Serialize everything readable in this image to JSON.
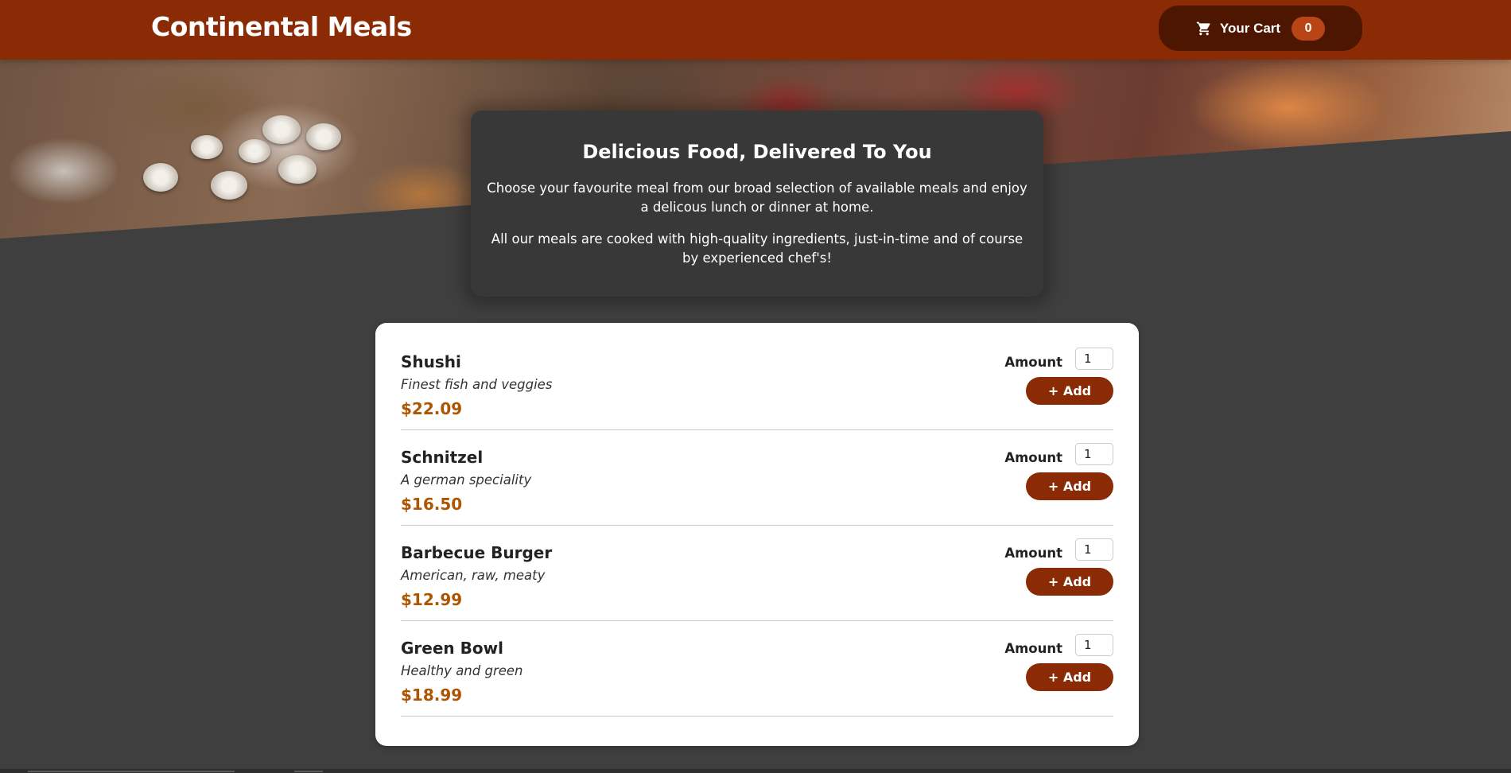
{
  "header": {
    "title": "Continental Meals",
    "cart": {
      "label": "Your Cart",
      "count": "0",
      "icon": "cart-icon"
    }
  },
  "summary": {
    "title": "Delicious Food, Delivered To You",
    "paragraph_1": "Choose your favourite meal from our broad selection of available meals and enjoy a delicous lunch or dinner at home.",
    "paragraph_2": "All our meals are cooked with high-quality ingredients, just-in-time and of course by experienced chef's!"
  },
  "meals": [
    {
      "name": "Shushi",
      "description": "Finest fish and veggies",
      "price": "$22.09",
      "amount_label": "Amount",
      "amount": "1",
      "add_label": "+ Add"
    },
    {
      "name": "Schnitzel",
      "description": "A german speciality",
      "price": "$16.50",
      "amount_label": "Amount",
      "amount": "1",
      "add_label": "+ Add"
    },
    {
      "name": "Barbecue Burger",
      "description": "American, raw, meaty",
      "price": "$12.99",
      "amount_label": "Amount",
      "amount": "1",
      "add_label": "+ Add"
    },
    {
      "name": "Green Bowl",
      "description": "Healthy and green",
      "price": "$18.99",
      "amount_label": "Amount",
      "amount": "1",
      "add_label": "+ Add"
    }
  ],
  "colors": {
    "header_bg": "#8a2b06",
    "cart_button_bg": "#4d1601",
    "cart_badge_bg": "#b94517",
    "page_bg": "#3f3f3f",
    "summary_bg": "#383838",
    "price": "#ad5502",
    "add_button_bg": "#8a2b06"
  }
}
